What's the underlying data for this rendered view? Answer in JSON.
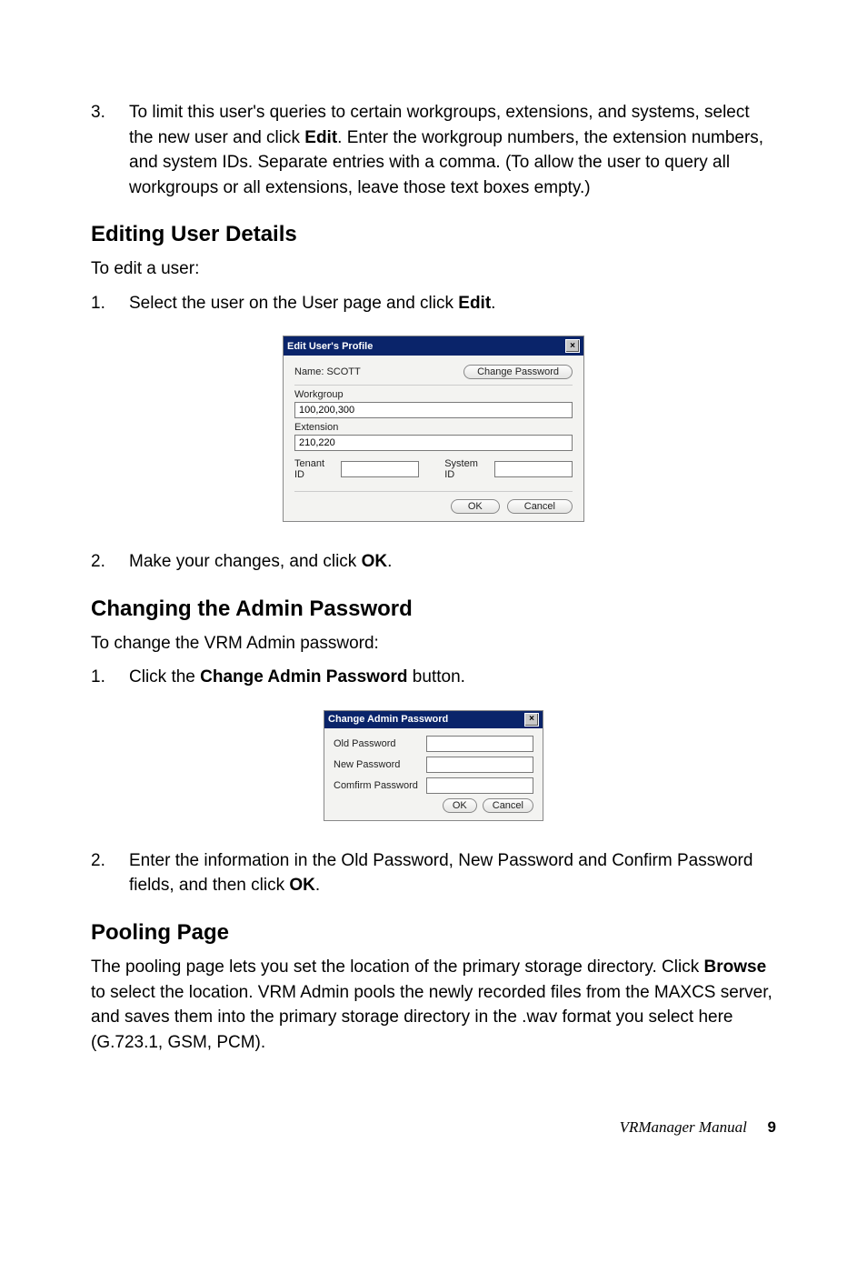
{
  "step3": {
    "num": "3.",
    "text_a": "To limit this user's queries to certain workgroups, extensions, and systems, select the new user and click ",
    "bold_a": "Edit",
    "text_b": ". Enter the workgroup numbers, the extension numbers, and system IDs. Separate entries with a comma. (To allow the user to query all workgroups or all extensions, leave those text boxes empty.)"
  },
  "editing_heading": "Editing User Details",
  "editing_intro": "To edit a user:",
  "editing_step1": {
    "num": "1.",
    "text_a": "Select the user on the User page and click ",
    "bold_a": "Edit",
    "text_b": "."
  },
  "dlg1": {
    "title": "Edit User's Profile",
    "name_label": "Name: SCOTT",
    "change_pw": "Change Password",
    "workgroup_label": "Workgroup",
    "workgroup_value": "100,200,300",
    "extension_label": "Extension",
    "extension_value": "210,220",
    "tenant_label": "Tenant ID",
    "system_label": "System ID",
    "ok": "OK",
    "cancel": "Cancel"
  },
  "editing_step2": {
    "num": "2.",
    "text_a": "Make your changes, and click ",
    "bold_a": "OK",
    "text_b": "."
  },
  "changing_heading": "Changing the Admin Password",
  "changing_intro": "To change the VRM Admin password:",
  "changing_step1": {
    "num": "1.",
    "text_a": "Click the ",
    "bold_a": "Change Admin Password",
    "text_b": " button."
  },
  "dlg2": {
    "title": "Change Admin Password",
    "old": "Old Password",
    "new": "New Password",
    "confirm": "Comfirm Password",
    "ok": "OK",
    "cancel": "Cancel"
  },
  "changing_step2": {
    "num": "2.",
    "text_a": "Enter the information in the Old Password, New Password and Confirm Password fields, and then click ",
    "bold_a": "OK",
    "text_b": "."
  },
  "pooling_heading": "Pooling Page",
  "pooling_para_a": "The pooling page lets you set the location of the primary storage directory. Click ",
  "pooling_bold": "Browse",
  "pooling_para_b": " to select the location. VRM Admin pools the newly recorded files from the MAXCS server, and saves them into the primary storage directory in the .wav format you select here (G.723.1, GSM, PCM).",
  "footer_title": "VRManager Manual",
  "footer_page": "9"
}
